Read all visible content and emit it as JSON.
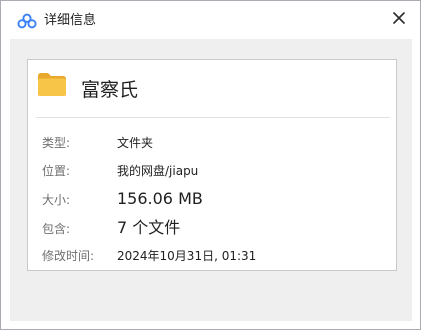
{
  "window": {
    "title": "详细信息",
    "app_icon": "cloud-logo-icon",
    "close_icon": "close-icon"
  },
  "file": {
    "icon": "folder-icon",
    "icon_color": "#f7c648",
    "name": "富察氏"
  },
  "details": [
    {
      "label": "类型:",
      "value": "文件夹"
    },
    {
      "label": "位置:",
      "value": "我的网盘/jiapu"
    },
    {
      "label": "大小:",
      "value": "156.06 MB"
    },
    {
      "label": "包含:",
      "value": "7 个文件"
    },
    {
      "label": "修改时间:",
      "value": "2024年10月31日, 01:31"
    }
  ],
  "colors": {
    "logo_blue": "#3b82f6",
    "background_gray": "#efefef",
    "card_border": "#c9c9c9"
  }
}
